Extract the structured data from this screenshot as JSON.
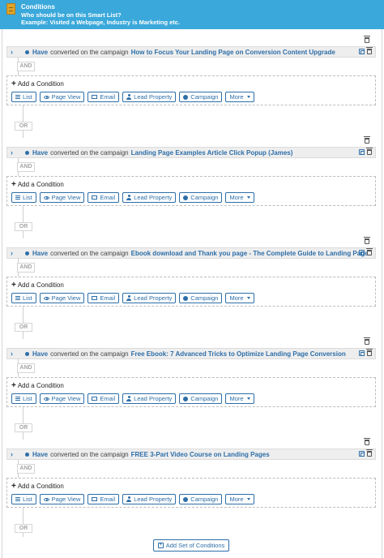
{
  "header": {
    "title": "Conditions",
    "subtitle": "Who should be on this Smart List?",
    "example": "Example: Visited a Webpage, Industry is Marketing etc."
  },
  "labels": {
    "have": "Have",
    "middle": "converted on the campaign",
    "and": "AND",
    "or": "OR",
    "add_condition": "Add a Condition",
    "add_condition_plus": "+",
    "add_set": "Add Set of Conditions",
    "add_set_plus": "+"
  },
  "buttons": [
    "List",
    "Page View",
    "Email",
    "Lead Property",
    "Campaign",
    "More"
  ],
  "condition_sets": [
    {
      "campaign": "How to Focus Your Landing Page on Conversion Content Upgrade"
    },
    {
      "campaign": "Landing Page Examples Article Click Popup (James)"
    },
    {
      "campaign": "Ebook download and Thank you page - The Complete Guide to Landing Pages"
    },
    {
      "campaign": "Free Ebook: 7 Advanced Tricks to Optimize Landing Page Conversion"
    },
    {
      "campaign": "FREE 3-Part Video Course on Landing Pages"
    }
  ],
  "icons": {
    "header": "smart-list-icon",
    "expand": "chevron-right-icon",
    "copy": "copy-icon",
    "delete": "trash-icon"
  },
  "colors": {
    "header_bg": "#3aa8da",
    "accent": "#2d6ea8"
  }
}
